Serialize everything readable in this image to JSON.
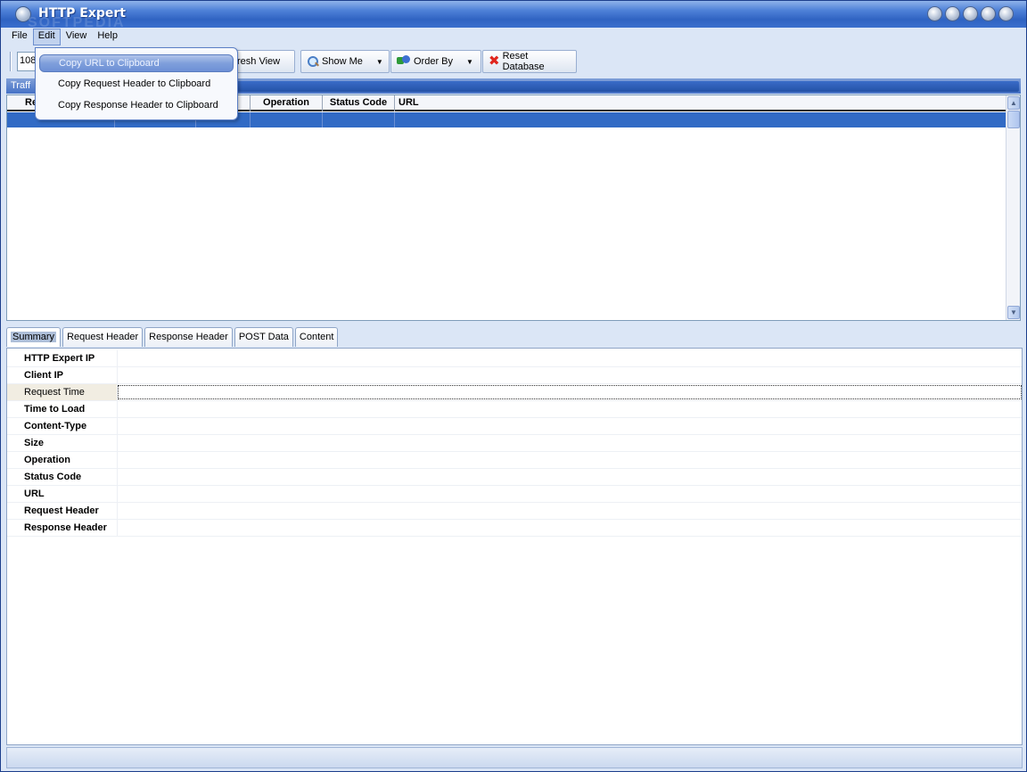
{
  "window": {
    "title": "HTTP Expert",
    "watermark": "SOFTPEDIA"
  },
  "menubar": {
    "items": [
      {
        "label": "File"
      },
      {
        "label": "Edit"
      },
      {
        "label": "View"
      },
      {
        "label": "Help"
      }
    ]
  },
  "toolbar": {
    "port_value": "1080",
    "refresh_label": "Refresh View",
    "refresh_visible": "resh View",
    "show_me_label": "Show Me",
    "order_by_label": "Order By",
    "reset_label": "Reset Database"
  },
  "traffic": {
    "header": "Traff",
    "columns": [
      {
        "label": "Re"
      },
      {
        "label": ""
      },
      {
        "label": ""
      },
      {
        "label": "Operation"
      },
      {
        "label": "Status Code"
      },
      {
        "label": "URL"
      }
    ]
  },
  "tabs": [
    {
      "label": "Summary",
      "active": true
    },
    {
      "label": "Request Header"
    },
    {
      "label": "Response Header"
    },
    {
      "label": "POST Data"
    },
    {
      "label": "Content"
    }
  ],
  "summary": {
    "rows": [
      {
        "label": "HTTP Expert IP",
        "value": ""
      },
      {
        "label": "Client IP",
        "value": ""
      },
      {
        "label": "Request Time",
        "value": ""
      },
      {
        "label": "Time to Load",
        "value": ""
      },
      {
        "label": "Content-Type",
        "value": ""
      },
      {
        "label": "Size",
        "value": ""
      },
      {
        "label": "Operation",
        "value": ""
      },
      {
        "label": "Status Code",
        "value": ""
      },
      {
        "label": "URL",
        "value": ""
      },
      {
        "label": "Request Header",
        "value": ""
      },
      {
        "label": "Response Header",
        "value": ""
      }
    ]
  },
  "edit_menu": {
    "items": [
      {
        "label": "Copy URL to Clipboard"
      },
      {
        "label": "Copy Request Header to Clipboard"
      },
      {
        "label": "Copy Response Header to Clipboard"
      }
    ]
  },
  "colors": {
    "selection": "#316ac5",
    "titlebar": "#2f63c2",
    "panel": "#dbe6f6"
  }
}
